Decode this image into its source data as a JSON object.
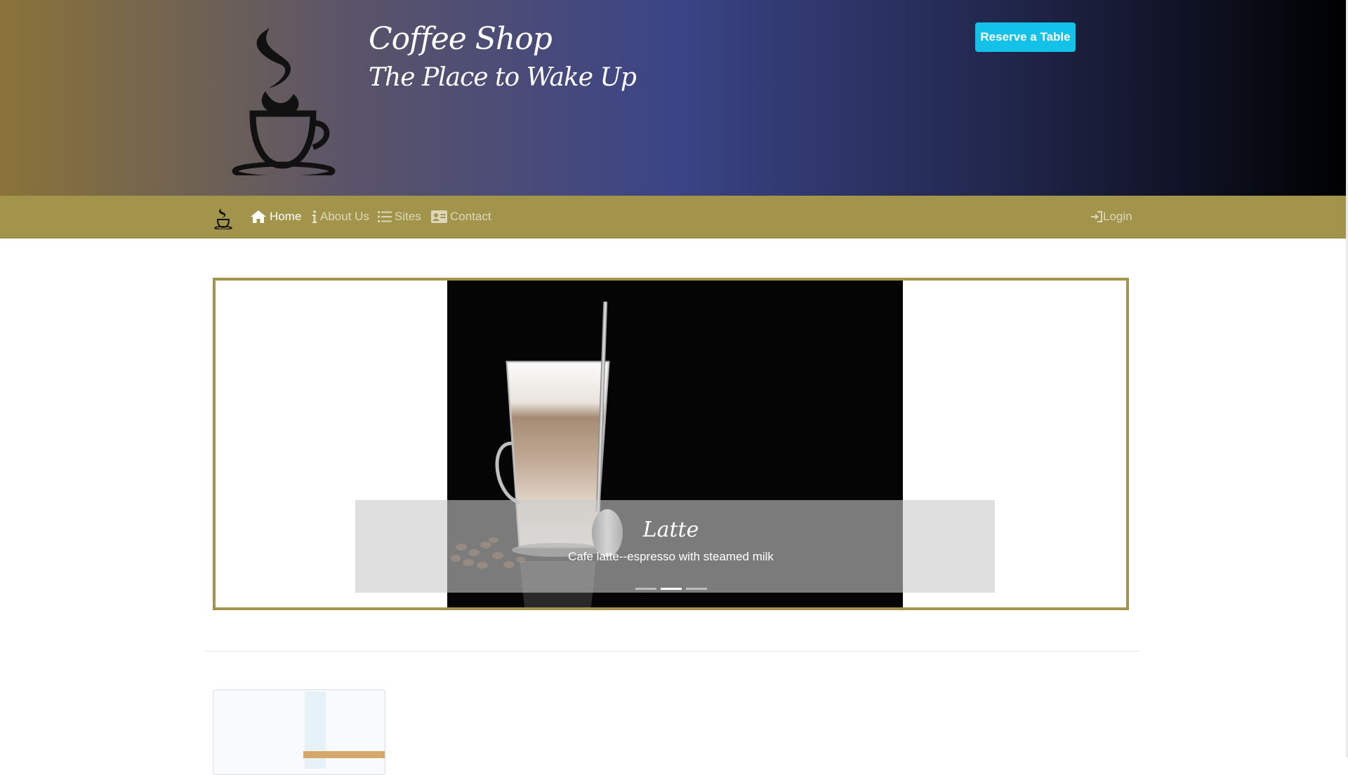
{
  "header": {
    "title": "Coffee Shop",
    "subtitle": "The Place to Wake Up",
    "reserve_label": "Reserve a Table"
  },
  "nav": {
    "items": [
      {
        "label": "Home",
        "icon": "home-icon",
        "active": true
      },
      {
        "label": "About Us",
        "icon": "info-icon",
        "active": false
      },
      {
        "label": "Sites",
        "icon": "list-icon",
        "active": false
      },
      {
        "label": "Contact",
        "icon": "address-card-icon",
        "active": false
      }
    ],
    "login_label": "Login",
    "login_icon": "sign-in-icon"
  },
  "carousel": {
    "slide_title": "Latte",
    "slide_text": "Cafe latte--espresso with steamed milk",
    "indicator_count": 3,
    "active_indicator": 2
  },
  "colors": {
    "nav_bg": "#a2954b",
    "accent": "#13c1e9",
    "frame_border": "#a2954b"
  }
}
